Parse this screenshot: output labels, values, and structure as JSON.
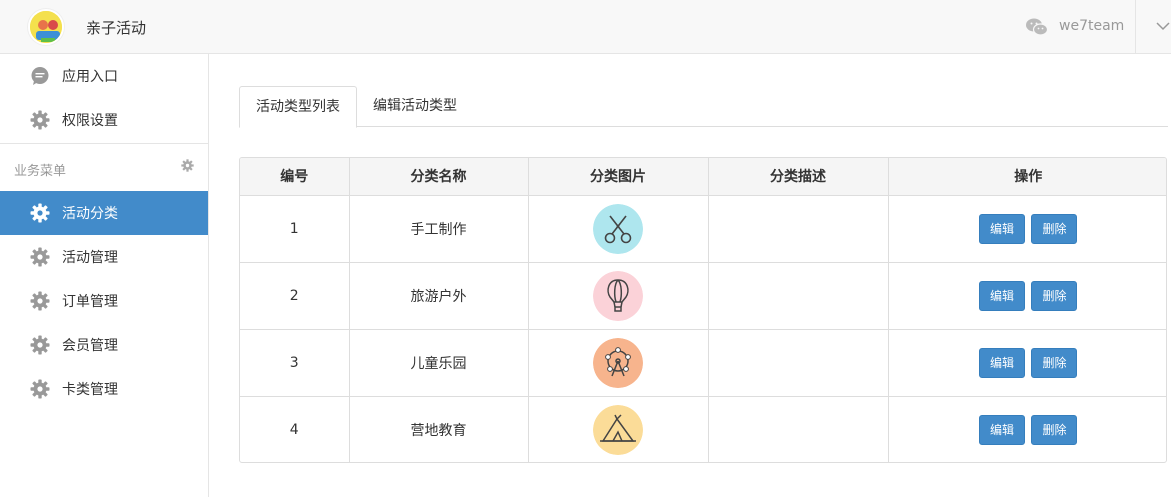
{
  "header": {
    "title": "亲子活动",
    "username": "we7team"
  },
  "sidebar": {
    "top_items": [
      {
        "label": "应用入口",
        "icon": "chat-bubble-icon"
      },
      {
        "label": "权限设置",
        "icon": "gear-icon"
      }
    ],
    "section_title": "业务菜单",
    "items": [
      {
        "label": "活动分类",
        "icon": "gear-icon",
        "active": true
      },
      {
        "label": "活动管理",
        "icon": "gear-icon"
      },
      {
        "label": "订单管理",
        "icon": "gear-icon"
      },
      {
        "label": "会员管理",
        "icon": "gear-icon"
      },
      {
        "label": "卡类管理",
        "icon": "gear-icon"
      }
    ]
  },
  "tabs": [
    {
      "label": "活动类型列表",
      "active": true
    },
    {
      "label": "编辑活动类型",
      "active": false
    }
  ],
  "table": {
    "columns": [
      "编号",
      "分类名称",
      "分类图片",
      "分类描述",
      "操作"
    ],
    "rows": [
      {
        "id": "1",
        "name": "手工制作",
        "icon": "scissors-icon",
        "color": "#aee6ee",
        "desc": ""
      },
      {
        "id": "2",
        "name": "旅游户外",
        "icon": "hot-air-balloon-icon",
        "color": "#fbd2d8",
        "desc": ""
      },
      {
        "id": "3",
        "name": "儿童乐园",
        "icon": "ferris-wheel-icon",
        "color": "#f7b48d",
        "desc": ""
      },
      {
        "id": "4",
        "name": "营地教育",
        "icon": "tent-icon",
        "color": "#fbdc98",
        "desc": ""
      }
    ],
    "edit_label": "编辑",
    "delete_label": "删除"
  },
  "colors": {
    "primary": "#428bca"
  }
}
